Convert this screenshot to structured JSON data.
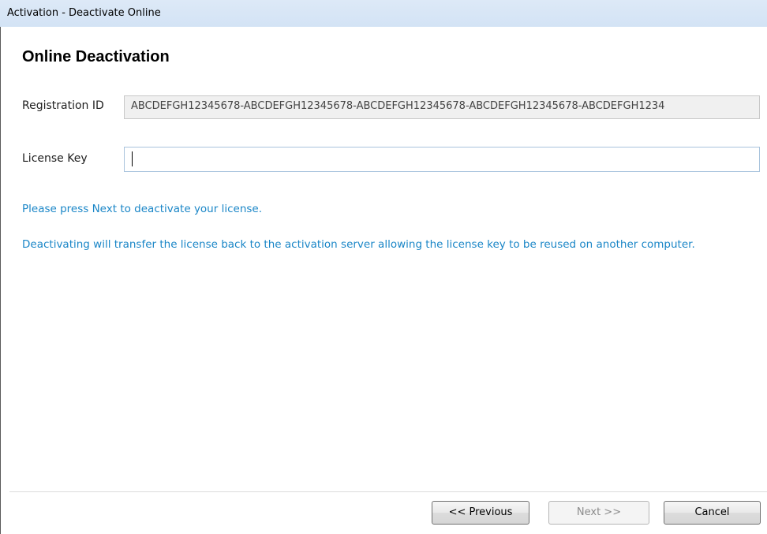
{
  "window": {
    "title": "Activation - Deactivate Online"
  },
  "page": {
    "heading": "Online Deactivation"
  },
  "form": {
    "registration_label": "Registration ID",
    "registration_value": "ABCDEFGH12345678-ABCDEFGH12345678-ABCDEFGH12345678-ABCDEFGH12345678-ABCDEFGH1234",
    "license_label": "License Key",
    "license_value": "",
    "license_placeholder": ""
  },
  "messages": {
    "instruction": "Please press Next to deactivate your license.",
    "explanation": "Deactivating will transfer the license back to the activation server allowing the license key to be reused on another computer."
  },
  "buttons": {
    "previous": "<< Previous",
    "next": "Next >>",
    "cancel": "Cancel"
  },
  "colors": {
    "info_text": "#1a86c7",
    "titlebar": "#d3e3f5"
  }
}
